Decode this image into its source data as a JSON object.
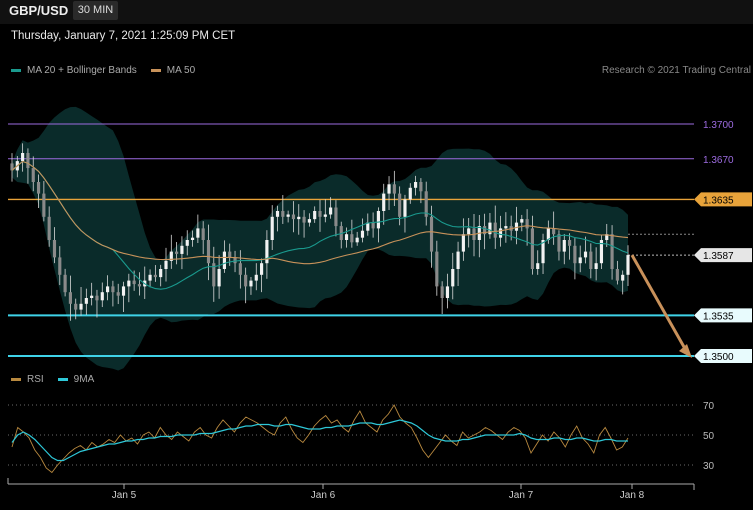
{
  "header": {
    "symbol": "GBP/USD",
    "timeframe": "30 MIN"
  },
  "timestamp": "Thursday, January 7, 2021 1:25:09 PM CET",
  "legend_top": {
    "item1": "MA 20 + Bollinger Bands",
    "item2": "MA 50",
    "credit": "Research © 2021 Trading Central"
  },
  "legend_bottom": {
    "item1": "RSI",
    "item2": "9MA"
  },
  "colors": {
    "ma20": "#1a9a8e",
    "ma50": "#c8925a",
    "bands": "#0d3a38",
    "resistance": "#9c6be0",
    "pivot": "#e8a33a",
    "support": "#3fd3e8",
    "arrow": "#c9915a",
    "candle": "#d9d9d9"
  },
  "chart_data": [
    {
      "type": "candlestick",
      "title": "GBP/USD",
      "ylim": [
        1.3487,
        1.3725
      ],
      "x_ticks": [
        "Jan 5",
        "Jan 6",
        "Jan 7",
        "Jan 8"
      ],
      "close_series": [
        1.366,
        1.3668,
        1.3675,
        1.3662,
        1.365,
        1.364,
        1.362,
        1.36,
        1.3585,
        1.357,
        1.3555,
        1.3545,
        1.354,
        1.3545,
        1.355,
        1.3552,
        1.3548,
        1.3555,
        1.356,
        1.3555,
        1.3552,
        1.356,
        1.3565,
        1.3562,
        1.356,
        1.3565,
        1.357,
        1.3568,
        1.3575,
        1.3582,
        1.359,
        1.3588,
        1.3595,
        1.36,
        1.3602,
        1.361,
        1.36,
        1.358,
        1.356,
        1.3575,
        1.359,
        1.3585,
        1.358,
        1.357,
        1.356,
        1.3565,
        1.357,
        1.358,
        1.36,
        1.362,
        1.3625,
        1.362,
        1.3622,
        1.3618,
        1.362,
        1.3615,
        1.3618,
        1.3625,
        1.362,
        1.3622,
        1.3628,
        1.3612,
        1.36,
        1.3605,
        1.3598,
        1.3602,
        1.3608,
        1.3615,
        1.361,
        1.3625,
        1.364,
        1.3648,
        1.364,
        1.362,
        1.3635,
        1.3645,
        1.365,
        1.3642,
        1.362,
        1.359,
        1.356,
        1.355,
        1.356,
        1.3575,
        1.359,
        1.3605,
        1.361,
        1.36,
        1.3612,
        1.3605,
        1.3615,
        1.3602,
        1.361,
        1.3612,
        1.3608,
        1.3615,
        1.3618,
        1.361,
        1.3575,
        1.358,
        1.36,
        1.361,
        1.3605,
        1.359,
        1.36,
        1.3595,
        1.358,
        1.3585,
        1.359,
        1.3575,
        1.358,
        1.36,
        1.3605,
        1.3575,
        1.3565,
        1.357,
        1.3587
      ],
      "levels": [
        {
          "value": 1.37,
          "label": "1.3700",
          "role": "resistance",
          "tag": false
        },
        {
          "value": 1.367,
          "label": "1.3670",
          "role": "resistance",
          "tag": false
        },
        {
          "value": 1.3635,
          "label": "1.3635",
          "role": "pivot",
          "tag": true
        },
        {
          "value": 1.3587,
          "label": "1.3587",
          "role": "last",
          "tag": true
        },
        {
          "value": 1.3535,
          "label": "1.3535",
          "role": "support",
          "tag": true
        },
        {
          "value": 1.35,
          "label": "1.3500",
          "role": "support",
          "tag": true
        }
      ],
      "series": [
        {
          "name": "MA 20 + Bollinger Bands"
        },
        {
          "name": "MA 50"
        }
      ],
      "projection": {
        "from": 1.3587,
        "to": 1.35,
        "direction": "down"
      }
    },
    {
      "type": "line",
      "ylim": [
        20,
        80
      ],
      "y_ticks": [
        30,
        50,
        70
      ],
      "series": [
        {
          "name": "RSI",
          "values": [
            42,
            55,
            52,
            48,
            40,
            35,
            28,
            25,
            30,
            34,
            38,
            41,
            43,
            40,
            45,
            42,
            44,
            47,
            45,
            50,
            46,
            48,
            44,
            50,
            52,
            48,
            55,
            50,
            47,
            52,
            49,
            46,
            52,
            55,
            50,
            48,
            55,
            60,
            56,
            52,
            58,
            62,
            60,
            58,
            55,
            52,
            50,
            58,
            62,
            54,
            48,
            45,
            50,
            56,
            60,
            63,
            58,
            60,
            55,
            52,
            60,
            66,
            58,
            55,
            52,
            60,
            64,
            70,
            62,
            58,
            55,
            48,
            40,
            35,
            40,
            45,
            50,
            46,
            43,
            52,
            48,
            50,
            52,
            55,
            53,
            50,
            47,
            52,
            55,
            53,
            48,
            38,
            44,
            50,
            46,
            52,
            48,
            42,
            50,
            56,
            48,
            44,
            38,
            50,
            55,
            48,
            40,
            42,
            48
          ],
          "color": "#b8893f"
        },
        {
          "name": "9MA",
          "values": [
            45,
            50,
            52,
            50,
            47,
            43,
            39,
            35,
            33,
            33,
            35,
            37,
            39,
            40,
            41,
            42,
            43,
            44,
            44,
            45,
            46,
            46,
            47,
            47,
            48,
            48,
            49,
            49,
            49,
            50,
            50,
            50,
            50,
            51,
            51,
            51,
            52,
            53,
            54,
            54,
            55,
            56,
            56,
            57,
            57,
            57,
            56,
            56,
            57,
            57,
            56,
            55,
            54,
            54,
            54,
            55,
            55,
            56,
            56,
            56,
            57,
            58,
            58,
            58,
            57,
            57,
            58,
            59,
            60,
            59,
            58,
            56,
            53,
            50,
            48,
            47,
            46,
            46,
            46,
            47,
            47,
            48,
            49,
            50,
            50,
            50,
            50,
            50,
            50,
            51,
            50,
            48,
            47,
            47,
            47,
            48,
            48,
            47,
            47,
            48,
            48,
            47,
            46,
            46,
            47,
            47,
            46,
            46,
            46
          ],
          "color": "#2ec8d8"
        }
      ]
    }
  ]
}
